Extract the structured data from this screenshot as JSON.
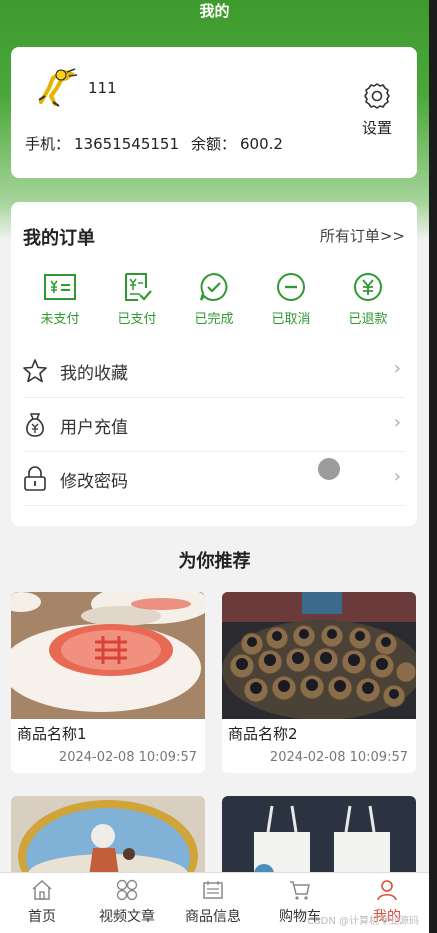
{
  "header": {
    "title": "我的"
  },
  "profile": {
    "username": "111",
    "phone_label": "手机：",
    "phone": "13651545151",
    "balance_label": "余额：",
    "balance": "600.2",
    "settings_label": "设置"
  },
  "orders": {
    "title": "我的订单",
    "all_link": "所有订单>>",
    "statuses": [
      {
        "label": "未支付",
        "icon": "unpaid-icon"
      },
      {
        "label": "已支付",
        "icon": "paid-icon"
      },
      {
        "label": "已完成",
        "icon": "completed-icon"
      },
      {
        "label": "已取消",
        "icon": "cancelled-icon"
      },
      {
        "label": "已退款",
        "icon": "refunded-icon"
      }
    ],
    "status_color": "#2f9a32"
  },
  "menu": [
    {
      "label": "我的收藏",
      "icon": "star-icon"
    },
    {
      "label": "用户充值",
      "icon": "money-bag-icon"
    },
    {
      "label": "修改密码",
      "icon": "lock-icon"
    }
  ],
  "recommend": {
    "title": "为你推荐",
    "products": [
      {
        "name": "商品名称1",
        "date": "2024-02-08 10:09:57"
      },
      {
        "name": "商品名称2",
        "date": "2024-02-08 10:09:57"
      }
    ]
  },
  "nav": {
    "items": [
      {
        "label": "首页",
        "icon": "home-icon"
      },
      {
        "label": "视频文章",
        "icon": "grid-icon"
      },
      {
        "label": "商品信息",
        "icon": "calendar-icon"
      },
      {
        "label": "购物车",
        "icon": "cart-icon"
      },
      {
        "label": "我的",
        "icon": "user-icon",
        "active": true
      }
    ],
    "active_color": "#e04b3a"
  },
  "watermark": "CSDN @计算机专业源码"
}
